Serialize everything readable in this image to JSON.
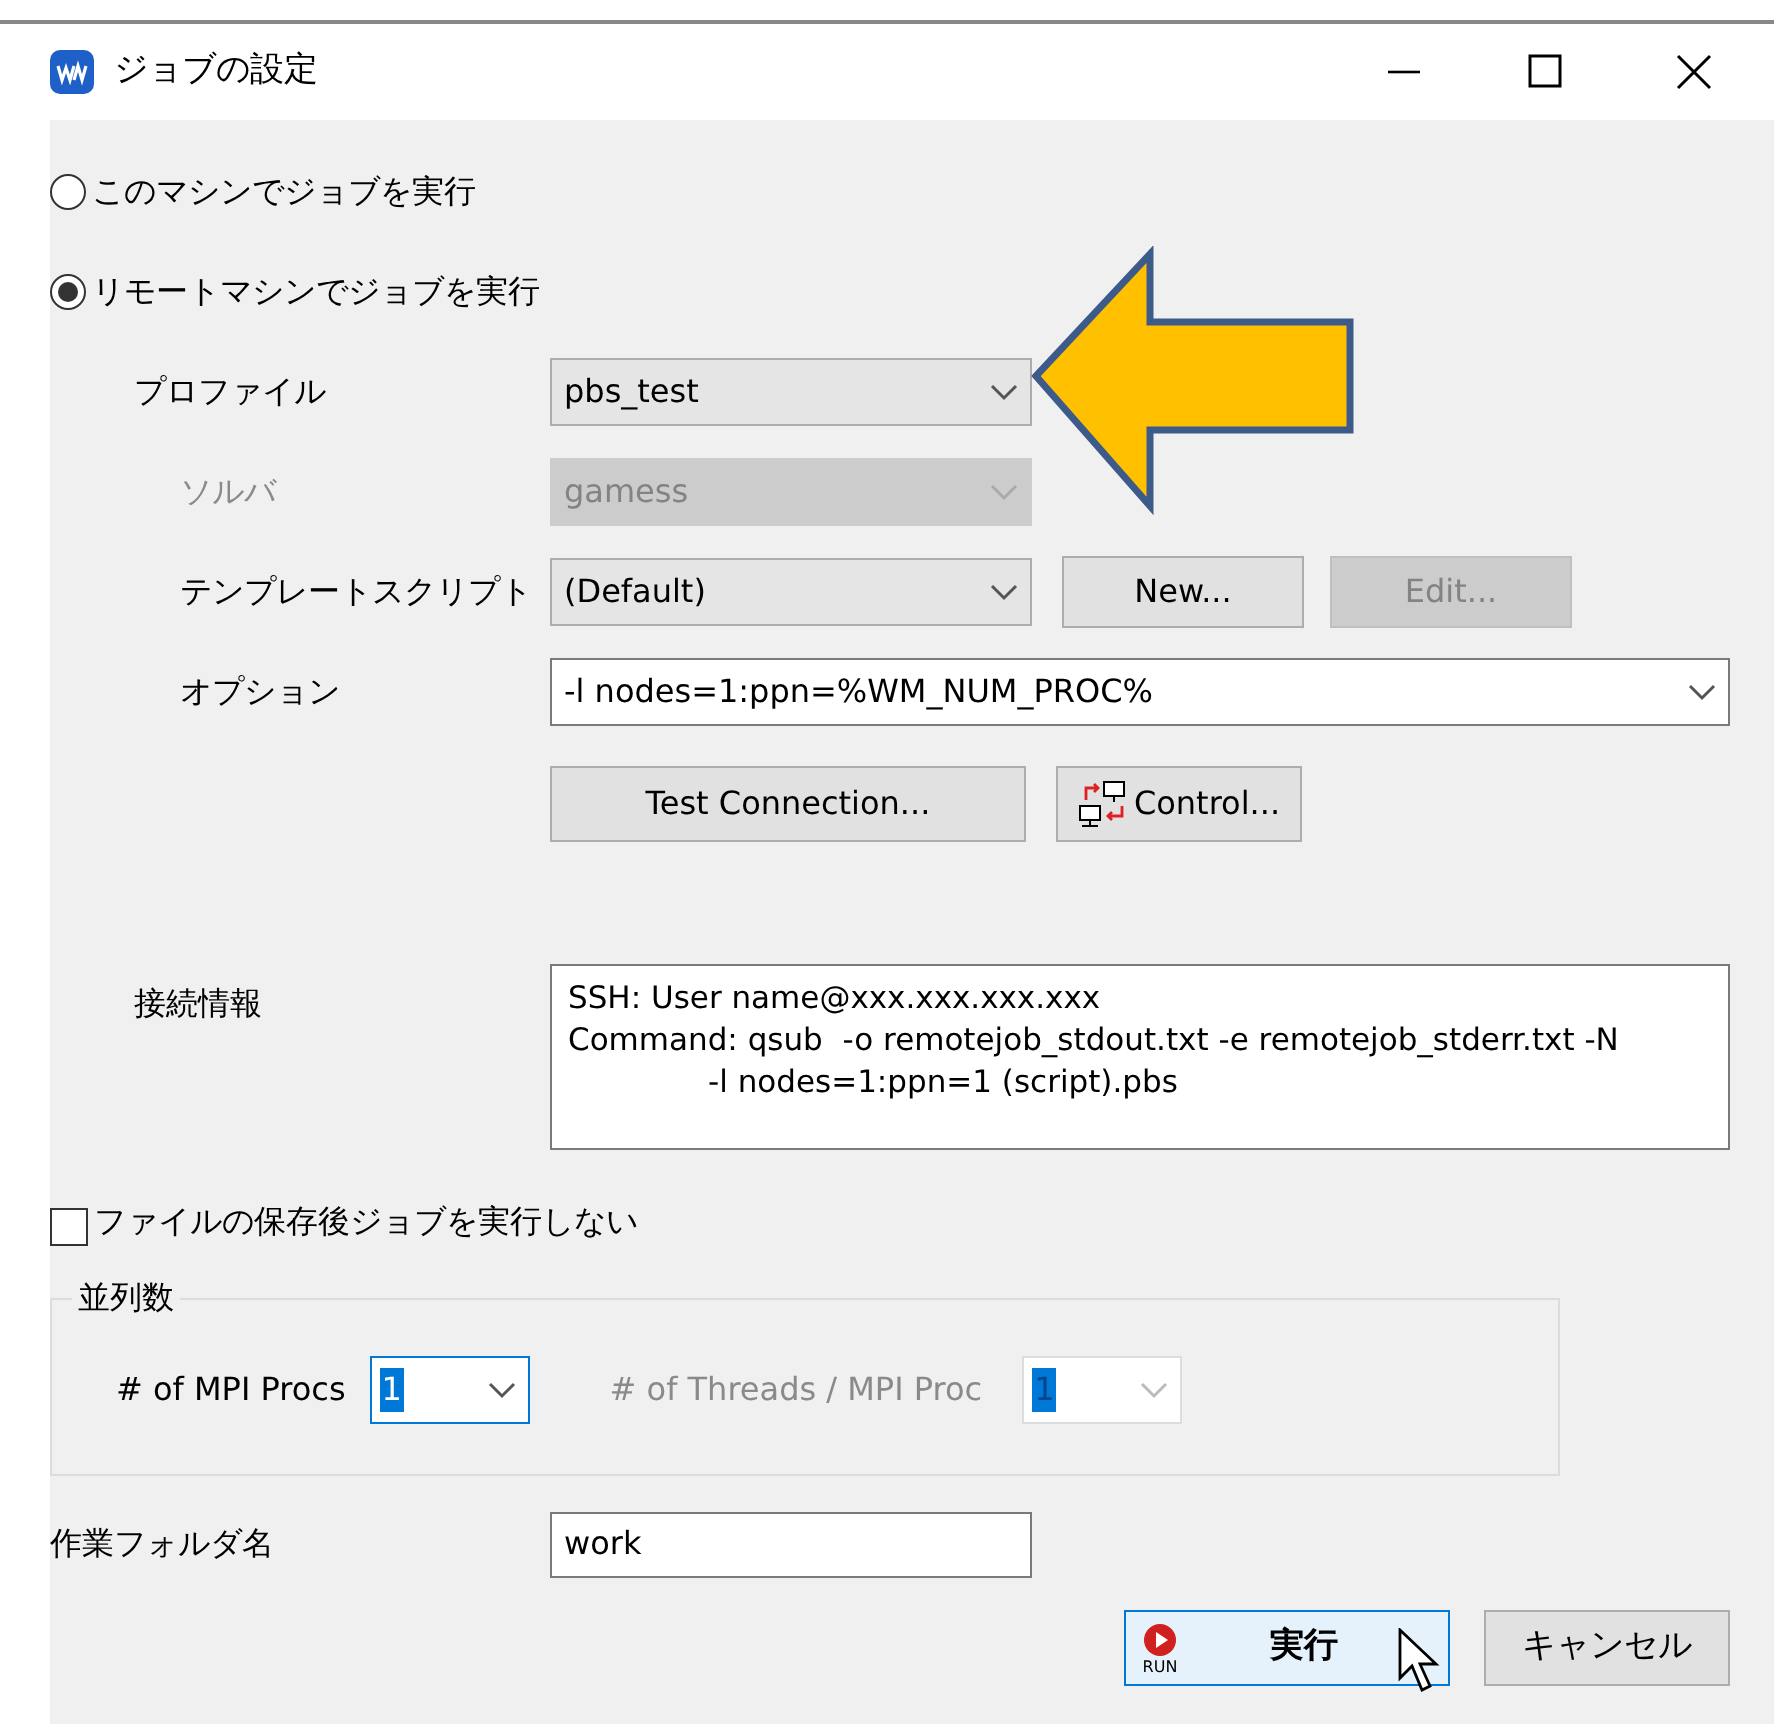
{
  "window": {
    "title": "ジョブの設定"
  },
  "run_mode": [
    {
      "label": "このマシンでジョブを実行",
      "selected": false
    },
    {
      "label": "リモートマシンでジョブを実行",
      "selected": true
    }
  ],
  "fields": [
    {
      "label": "プロファイル",
      "value": "pbs_test",
      "disabled": false
    },
    {
      "label": "ソルバ",
      "value": "gamess",
      "disabled": true
    },
    {
      "label": "テンプレートスクリプト",
      "value": "(Default)",
      "disabled": false
    }
  ],
  "template_buttons": [
    {
      "label": "New...",
      "disabled": false
    },
    {
      "label": "Edit...",
      "disabled": true
    }
  ],
  "option": {
    "label": "オプション",
    "value": "-l nodes=1:ppn=%WM_NUM_PROC%"
  },
  "action_buttons": [
    {
      "label": "Test Connection...",
      "kind": "text"
    },
    {
      "label": "Control...",
      "kind": "icon"
    }
  ],
  "connection_info": {
    "label": "接続情報",
    "lines": [
      {
        "text": "SSH: User name@xxx.xxx.xxx.xxx",
        "indented": false
      },
      {
        "text": "Command: qsub  -o remotejob_stdout.txt -e remotejob_stderr.txt -N",
        "indented": false
      },
      {
        "text": "-l nodes=1:ppn=1 (script).pbs",
        "indented": true
      }
    ]
  },
  "no_run_after_save": {
    "label": "ファイルの保存後ジョブを実行しない",
    "checked": false
  },
  "parallel": {
    "title": "並列数",
    "procs": [
      {
        "label": "# of MPI Procs",
        "value": "1",
        "disabled": false,
        "focused": true
      },
      {
        "label": "# of Threads / MPI Proc",
        "value": "1",
        "disabled": true,
        "focused": false
      }
    ]
  },
  "work_folder": {
    "label": "作業フォルダ名",
    "value": "work"
  },
  "buttons": [
    {
      "label": "実行",
      "kind": "run",
      "icon_text": "RUN",
      "focused": true
    },
    {
      "label": "キャンセル",
      "kind": "plain",
      "focused": false
    }
  ]
}
